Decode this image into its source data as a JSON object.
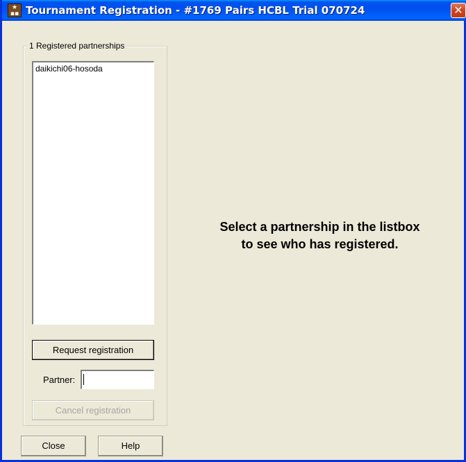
{
  "window": {
    "title": "Tournament Registration - #1769 Pairs HCBL Trial 070724",
    "icon": "app-icon",
    "close_glyph": "✕",
    "title_color": "#ffffff",
    "titlebar_color": "#0053ee"
  },
  "partnerships": {
    "group_label": "1 Registered partnerships",
    "items": [
      {
        "label": "daikichi06-hosoda"
      }
    ]
  },
  "form": {
    "request_label": "Request registration",
    "partner_label": "Partner:",
    "partner_value": "",
    "cancel_label": "Cancel registration"
  },
  "footer": {
    "close_label": "Close",
    "help_label": "Help"
  },
  "main": {
    "message_line1": "Select a partnership in the listbox",
    "message_line2": "to see who has registered."
  }
}
